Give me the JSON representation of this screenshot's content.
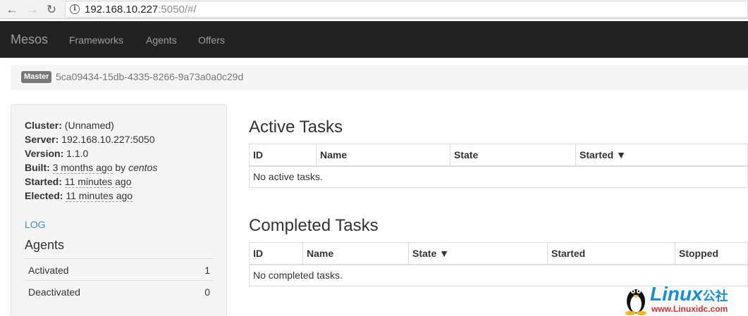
{
  "browser": {
    "url_host": "192.168.10.227",
    "url_rest": ":5050/#/"
  },
  "navbar": {
    "brand": "Mesos",
    "links": [
      "Frameworks",
      "Agents",
      "Offers"
    ]
  },
  "breadcrumb": {
    "label": "Master",
    "id": "5ca09434-15db-4335-8266-9a73a0a0c29d"
  },
  "sidebar": {
    "cluster": {
      "label": "Cluster:",
      "value": "(Unnamed)"
    },
    "server": {
      "label": "Server:",
      "value": "192.168.10.227:5050"
    },
    "version": {
      "label": "Version:",
      "value": "1.1.0"
    },
    "built": {
      "label": "Built:",
      "value": "3 months ago",
      "by": "by",
      "user": "centos"
    },
    "started": {
      "label": "Started:",
      "value": "11 minutes ago"
    },
    "elected": {
      "label": "Elected:",
      "value": "11 minutes ago"
    },
    "log_link": "LOG",
    "agents_heading": "Agents",
    "agents": [
      {
        "label": "Activated",
        "count": "1"
      },
      {
        "label": "Deactivated",
        "count": "0"
      }
    ]
  },
  "active_tasks": {
    "heading": "Active Tasks",
    "columns": [
      "ID",
      "Name",
      "State",
      "Started ▼"
    ],
    "empty": "No active tasks."
  },
  "completed_tasks": {
    "heading": "Completed Tasks",
    "columns": [
      "ID",
      "Name",
      "State ▼",
      "Started",
      "Stopped"
    ],
    "empty": "No completed tasks."
  },
  "watermark": {
    "brand": "Linux",
    "brand_cn": "公社",
    "url": "www.Linuxidc.com"
  }
}
